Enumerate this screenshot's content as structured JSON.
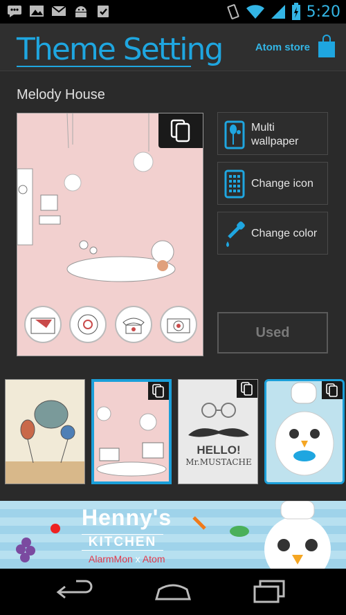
{
  "status_bar": {
    "time": "5:20",
    "left_icons": [
      "chat-icon",
      "image-icon",
      "gmail-icon",
      "android-icon",
      "clipboard-check-icon"
    ],
    "right_icons": [
      "vibrate-icon",
      "wifi-icon",
      "signal-icon",
      "battery-icon"
    ]
  },
  "header": {
    "title": "Theme Setting",
    "store_label": "Atom store",
    "accent_color": "#1fa6e0"
  },
  "theme": {
    "name": "Melody House"
  },
  "actions": {
    "multi_wallpaper": "Multi\nwallpaper",
    "change_icon": "Change icon",
    "change_color": "Change color",
    "used": "Used"
  },
  "dock_icons": [
    "envelope-icon",
    "camera-lens-icon",
    "telephone-icon",
    "camera-icon"
  ],
  "thumbnails": [
    {
      "name": "balloon-fish-theme",
      "selected": false
    },
    {
      "name": "melody-house-theme",
      "selected": true
    },
    {
      "name": "mustache-theme",
      "selected": false,
      "text_line1": "HELLO!",
      "text_line2": "Mr.MUSTACHE"
    },
    {
      "name": "chicken-chef-theme",
      "selected": false
    }
  ],
  "banner": {
    "title": "Henny's",
    "subtitle": "KITCHEN",
    "partner_a": "AlarmMon",
    "partner_x": " x ",
    "partner_b": "Atom"
  },
  "nav": [
    "back-icon",
    "home-icon",
    "recent-apps-icon"
  ]
}
